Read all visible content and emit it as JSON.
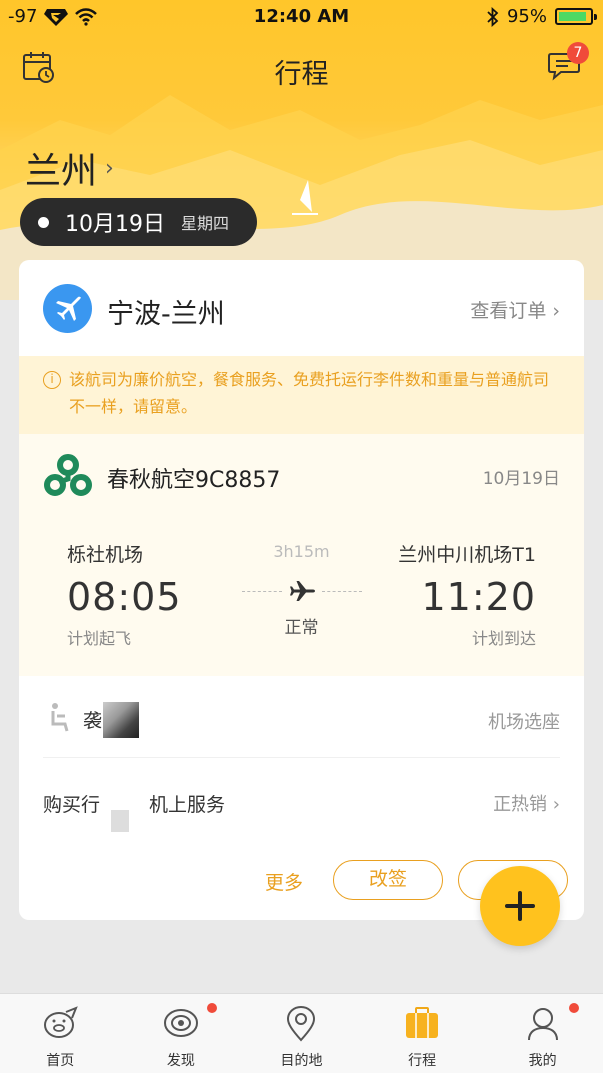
{
  "status_bar": {
    "signal": "-97",
    "time": "12:40 AM",
    "battery": "95%"
  },
  "nav": {
    "title": "行程",
    "message_badge": "7"
  },
  "hero": {
    "city": "兰州",
    "date": "10月19日",
    "weekday": "星期四"
  },
  "card": {
    "route": "宁波-兰州",
    "view_order": "查看订单",
    "notice": "该航司为廉价航空，餐食服务、免费托运行李件数和重量与普通航司不一样，请留意。",
    "airline": "春秋航空9C8857",
    "flight_date": "10月19日",
    "departure": {
      "airport": "栎社机场",
      "time": "08:05",
      "label": "计划起飞"
    },
    "arrival": {
      "airport": "兰州中川机场T1",
      "time": "11:20",
      "label": "计划到达"
    },
    "duration": "3h15m",
    "status": "正常",
    "seat_row": {
      "label": "袭",
      "right": "机场选座"
    },
    "service_row": {
      "label": "购买行",
      "label2": "机上服务",
      "right": "正热销"
    },
    "actions": {
      "more": "更多",
      "change": "改签"
    }
  },
  "tabbar": {
    "items": [
      {
        "label": "首页",
        "dot": false
      },
      {
        "label": "发现",
        "dot": true
      },
      {
        "label": "目的地",
        "dot": false
      },
      {
        "label": "行程",
        "dot": false
      },
      {
        "label": "我的",
        "dot": true
      }
    ]
  },
  "colors": {
    "accent": "#ffc21e",
    "orange_text": "#e9a020",
    "airline_green": "#1f8a5a",
    "plane_blue": "#3a97f0",
    "badge_red": "#f04b3a"
  }
}
